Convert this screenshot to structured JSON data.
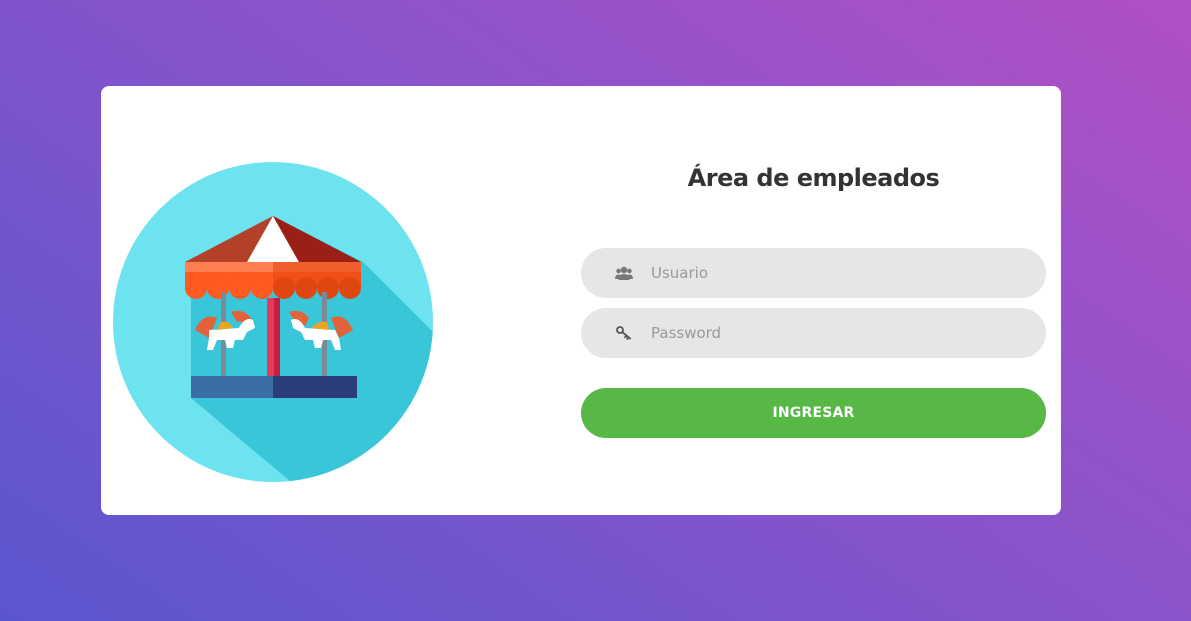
{
  "login": {
    "title": "Área de empleados",
    "username": {
      "placeholder": "Usuario",
      "value": "",
      "icon": "users-icon"
    },
    "password": {
      "placeholder": "Password",
      "value": "",
      "icon": "key-icon"
    },
    "submit_label": "INGRESAR"
  },
  "illustration": {
    "icon": "carousel-icon"
  },
  "colors": {
    "background_start": "#b150c4",
    "background_end": "#5a56cf",
    "card": "#ffffff",
    "field": "#e6e6e6",
    "button": "#57b846",
    "circle": "#6ee3f0"
  }
}
